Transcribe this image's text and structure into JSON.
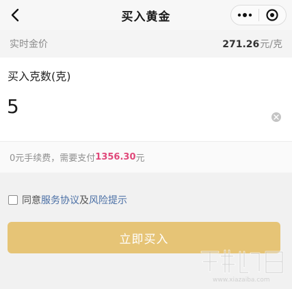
{
  "nav": {
    "title": "买入黄金",
    "back_icon": "chevron-left-icon",
    "more_icon": "more-dots-icon",
    "record_icon": "target-icon"
  },
  "price": {
    "label": "实时金价",
    "value": "271.26",
    "unit": "元/克"
  },
  "quantity": {
    "label": "买入克数(克)",
    "value": "5",
    "clear_icon": "clear-icon"
  },
  "fee": {
    "prefix": "0元手续费，需要支付",
    "amount": "1356.30",
    "suffix": "元"
  },
  "agreement": {
    "text1": "同意",
    "link1": "服务协议",
    "text2": "及",
    "link2": "风险提示",
    "checked": false
  },
  "buy_button": {
    "label": "立即买入"
  },
  "colors": {
    "accent": "#e6c476",
    "amount": "#e0487a",
    "link": "#4a6fa5"
  }
}
